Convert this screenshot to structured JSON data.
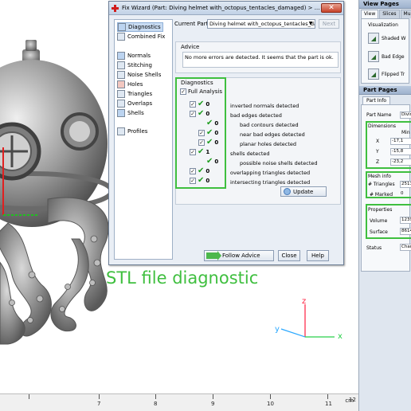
{
  "annotation": "STL file diagnostic",
  "axes": {
    "x": "x",
    "y": "y",
    "z": "z"
  },
  "ruler": {
    "ticks": [
      "7",
      "8",
      "9",
      "10",
      "11",
      "12"
    ],
    "unit": "cm"
  },
  "view_pages": {
    "title": "View Pages",
    "tabs": [
      "View",
      "Slices",
      "Multi-"
    ],
    "section": "Visualization",
    "buttons": [
      "Shaded W",
      "Bad Edge",
      "Flipped Tr"
    ]
  },
  "part_pages": {
    "title": "Part Pages",
    "tab": "Part Info",
    "part_name_label": "Part Name",
    "part_name_value": "Diving",
    "dimensions_label": "Dimensions",
    "min_label": "Min",
    "dims": [
      {
        "axis": "X",
        "value": "-17,1"
      },
      {
        "axis": "Y",
        "value": "-15,8"
      },
      {
        "axis": "Z",
        "value": "-23,2"
      }
    ],
    "mesh_label": "Mesh info",
    "triangles_label": "# Triangles",
    "triangles_value": "2513",
    "marked_label": "# Marked",
    "marked_value": "0",
    "properties_label": "Properties",
    "volume_label": "Volume",
    "volume_value": "1239",
    "surface_label": "Surface",
    "surface_value": "8614",
    "status_label": "Status",
    "status_value": "Chang"
  },
  "dialog": {
    "title": "Fix Wizard (Part: Diving helmet with_octopus_tentacles_damaged) > ...",
    "nav": [
      "Diagnostics",
      "Combined Fix",
      "Normals",
      "Stitching",
      "Noise Shells",
      "Holes",
      "Triangles",
      "Overlaps",
      "Shells",
      "Profiles"
    ],
    "current_part_label": "Current Part:",
    "current_part_value": "Diving helmet with_octopus_tentacles_damag",
    "next_label": "Next",
    "advice_title": "Advice",
    "advice_text": "No more errors are detected. It seems that the part is ok.",
    "diagnostics_title": "Diagnostics",
    "full_analysis": "Full Analysis",
    "rows": [
      {
        "count": "0",
        "label": "inverted normals detected"
      },
      {
        "count": "0",
        "label": "bad edges detected"
      },
      {
        "count": "0",
        "label": "bad contours detected"
      },
      {
        "count": "0",
        "label": "near bad edges detected"
      },
      {
        "count": "0",
        "label": "planar holes detected"
      },
      {
        "count": "1",
        "label": "shells detected"
      },
      {
        "count": "0",
        "label": "possible noise shells detected"
      },
      {
        "count": "0",
        "label": "overlapping triangles detected"
      },
      {
        "count": "0",
        "label": "intersecting triangles detected"
      }
    ],
    "update_label": "Update",
    "follow_advice_label": "Follow Advice",
    "close_label": "Close",
    "help_label": "Help"
  }
}
